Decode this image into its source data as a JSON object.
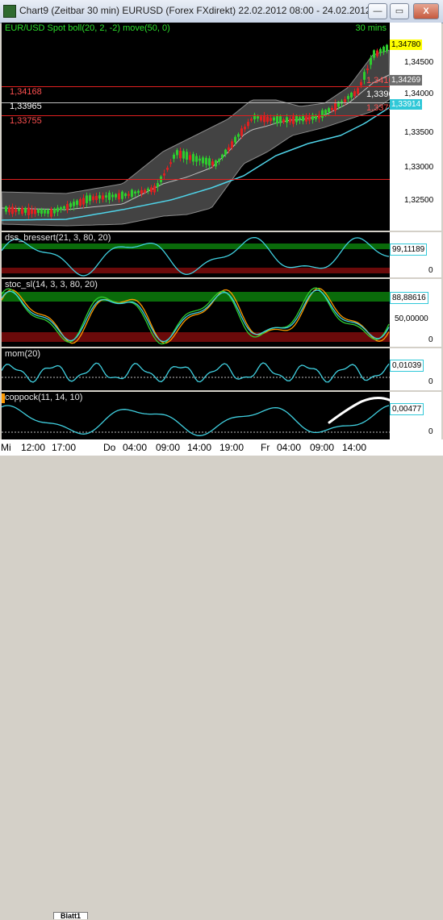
{
  "window": {
    "title": "Chart9 (Zeitbar 30 min)  EURUSD (Forex FXdirekt) 22.02.2012 08:00 - 24.02.2012 ...",
    "min_glyph": "—",
    "restore_glyph": "▭",
    "close_glyph": "X"
  },
  "main": {
    "title": "EUR/USD Spot  boll(20, 2, -2)  move(50, 0)",
    "timeframe": "30 mins",
    "levels": [
      "1,34168",
      "1,33965",
      "1,33755"
    ],
    "right_tags": [
      "1,34169",
      "1,33965",
      "1,33755"
    ],
    "price_tags": {
      "last": "1,34780",
      "upper_band": "1,34269",
      "ma": "1,33914"
    },
    "axis_labels": [
      "1,34500",
      "1,34000",
      "1,33500",
      "1,33000",
      "1,32500"
    ]
  },
  "indicators": {
    "dss": {
      "title": "dss_bressert(21, 3, 80, 20)",
      "value": "99,11189",
      "zero": "0"
    },
    "stoc": {
      "title": "stoc_sl(14, 3, 3, 80, 20)",
      "value": "88,88616",
      "mid": "50,00000",
      "zero": "0"
    },
    "mom": {
      "title": "mom(20)",
      "value": "0,01039",
      "zero": "0"
    },
    "coppock": {
      "title": "coppock(11, 14, 10)",
      "value": "0,00477",
      "zero": "0"
    }
  },
  "xaxis": {
    "labels": [
      "Mi",
      "12:00",
      "17:00",
      "Do",
      "04:00",
      "09:00",
      "14:00",
      "19:00",
      "Fr",
      "04:00",
      "09:00",
      "14:00"
    ]
  },
  "tabs": {
    "active": "Blatt1"
  },
  "colors": {
    "bull": "#2ecc2e",
    "bear": "#e02020",
    "band": "#5a5a5a",
    "ma": "#4fd3e8",
    "level": "#e02020",
    "zone_green": "#0a6b0a",
    "zone_red": "#6b0a0a",
    "line": "#40d0e0"
  }
}
